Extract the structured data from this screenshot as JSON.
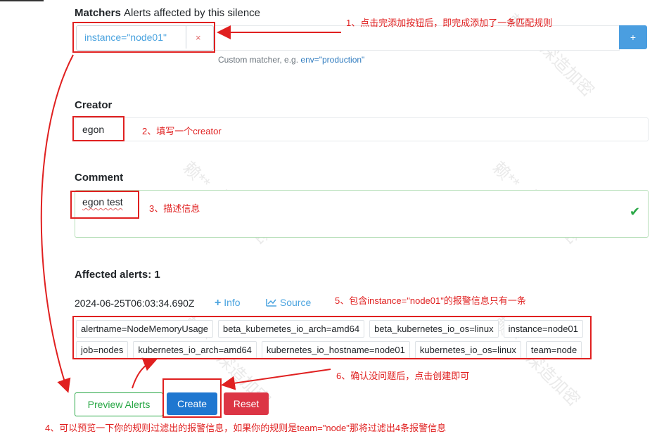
{
  "matchers": {
    "title": "Matchers",
    "subtitle": "Alerts affected by this silence",
    "matcher_value": "instance=\"node01\"",
    "remove_symbol": "×",
    "add_symbol": "+",
    "help_text": "Custom matcher, e.g.",
    "help_example": "env=\"production\""
  },
  "creator": {
    "title": "Creator",
    "value": "egon"
  },
  "comment": {
    "title": "Comment",
    "value": "egon test",
    "valid_symbol": "✔"
  },
  "affected": {
    "title": "Affected alerts: 1",
    "timestamp": "2024-06-25T06:03:34.690Z",
    "info_label": "Info",
    "source_label": "Source",
    "labels_row1": [
      "alertname=NodeMemoryUsage",
      "beta_kubernetes_io_arch=amd64",
      "beta_kubernetes_io_os=linux",
      "instance=node01"
    ],
    "labels_row2": [
      "job=nodes",
      "kubernetes_io_arch=amd64",
      "kubernetes_io_hostname=node01",
      "kubernetes_io_os=linux",
      "team=node"
    ]
  },
  "buttons": {
    "preview": "Preview Alerts",
    "create": "Create",
    "reset": "Reset"
  },
  "annotations": {
    "note1": "1、点击完添加按钮后，即完成添加了一条匹配规则",
    "note2": "2、填写一个creator",
    "note3": "3、描述信息",
    "note4": "4、可以预览一下你的规则过滤出的报警信息，如果你的规则是team=\"node\"那将过滤出4条报警信息",
    "note5": "5、包含instance=\"node01\"的报警信息只有一条",
    "note6": "6、确认没问题后，点击创建即可"
  },
  "watermark": {
    "text1": "赖**",
    "text2": "深造加密"
  },
  "colors": {
    "primary": "#1f77d0",
    "danger": "#dc3545",
    "success": "#28a745",
    "annotation": "#e02020",
    "link": "#4aa3df"
  }
}
